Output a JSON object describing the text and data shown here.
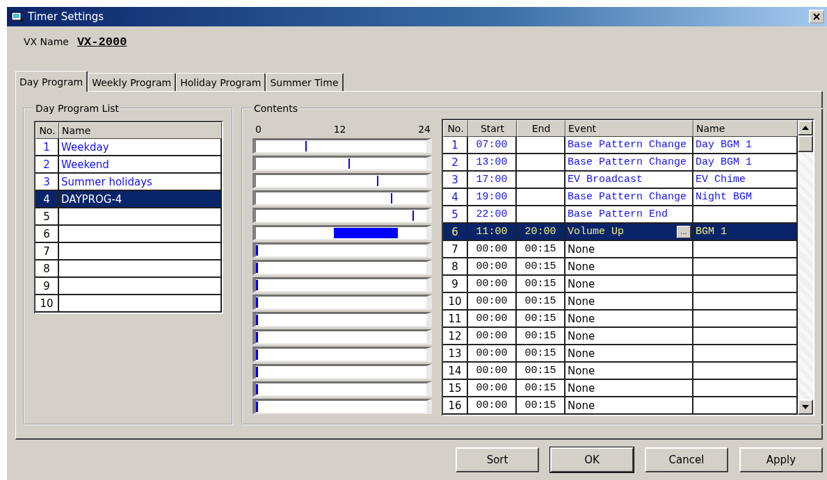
{
  "window": {
    "title": "Timer Settings"
  },
  "vx_name": {
    "label": "VX Name",
    "value": "VX-2000"
  },
  "tabs": [
    {
      "label": "Day Program",
      "selected": true
    },
    {
      "label": "Weekly Program",
      "selected": false
    },
    {
      "label": "Holiday Program",
      "selected": false
    },
    {
      "label": "Summer Time",
      "selected": false
    }
  ],
  "program_list": {
    "title": "Day Program List",
    "columns": [
      "No.",
      "Name"
    ],
    "rows": [
      {
        "no": "1",
        "name": "Weekday",
        "defined": true,
        "selected": false
      },
      {
        "no": "2",
        "name": "Weekend",
        "defined": true,
        "selected": false
      },
      {
        "no": "3",
        "name": "Summer holidays",
        "defined": true,
        "selected": false
      },
      {
        "no": "4",
        "name": "DAYPROG-4",
        "defined": true,
        "selected": true
      },
      {
        "no": "5",
        "defined": false,
        "selected": false
      },
      {
        "no": "6",
        "defined": false,
        "selected": false
      },
      {
        "no": "7",
        "defined": false,
        "selected": false
      },
      {
        "no": "8",
        "defined": false,
        "selected": false
      },
      {
        "no": "9",
        "defined": false,
        "selected": false
      },
      {
        "no": "10",
        "defined": false,
        "selected": false
      }
    ]
  },
  "contents": {
    "title": "Contents",
    "axis_labels": [
      "0",
      "12",
      "24"
    ],
    "columns": [
      "No.",
      "Start",
      "End",
      "Event",
      "Name"
    ],
    "edit_button": "...",
    "rows": [
      {
        "no": "1",
        "start": "07:00",
        "event": "Base Pattern Change",
        "name": "Day BGM 1",
        "defined": true,
        "selected": false
      },
      {
        "no": "2",
        "start": "13:00",
        "event": "Base Pattern Change",
        "name": "Day BGM 1",
        "defined": true,
        "selected": false
      },
      {
        "no": "3",
        "start": "17:00",
        "event": "EV Broadcast",
        "name": "EV Chime",
        "defined": true,
        "selected": false
      },
      {
        "no": "4",
        "start": "19:00",
        "event": "Base Pattern Change",
        "name": "Night BGM",
        "defined": true,
        "selected": false
      },
      {
        "no": "5",
        "start": "22:00",
        "event": "Base Pattern End",
        "defined": true,
        "selected": false
      },
      {
        "no": "6",
        "start": "11:00",
        "end": "20:00",
        "event": "Volume Up",
        "name": "BGM 1",
        "defined": true,
        "selected": true
      },
      {
        "no": "7",
        "start": "00:00",
        "end": "00:15",
        "event": "None",
        "defined": false,
        "selected": false
      },
      {
        "no": "8",
        "start": "00:00",
        "end": "00:15",
        "event": "None",
        "defined": false,
        "selected": false
      },
      {
        "no": "9",
        "start": "00:00",
        "end": "00:15",
        "event": "None",
        "defined": false,
        "selected": false
      },
      {
        "no": "10",
        "start": "00:00",
        "end": "00:15",
        "event": "None",
        "defined": false,
        "selected": false
      },
      {
        "no": "11",
        "start": "00:00",
        "end": "00:15",
        "event": "None",
        "defined": false,
        "selected": false
      },
      {
        "no": "12",
        "start": "00:00",
        "end": "00:15",
        "event": "None",
        "defined": false,
        "selected": false
      },
      {
        "no": "13",
        "start": "00:00",
        "end": "00:15",
        "event": "None",
        "defined": false,
        "selected": false
      },
      {
        "no": "14",
        "start": "00:00",
        "end": "00:15",
        "event": "None",
        "defined": false,
        "selected": false
      },
      {
        "no": "15",
        "start": "00:00",
        "end": "00:15",
        "event": "None",
        "defined": false,
        "selected": false
      },
      {
        "no": "16",
        "start": "00:00",
        "end": "00:15",
        "event": "None",
        "defined": false,
        "selected": false
      }
    ]
  },
  "buttons": [
    {
      "label": "Sort",
      "default": false
    },
    {
      "label": "OK",
      "default": true
    },
    {
      "label": "Cancel",
      "default": false
    },
    {
      "label": "Apply",
      "default": false
    }
  ]
}
